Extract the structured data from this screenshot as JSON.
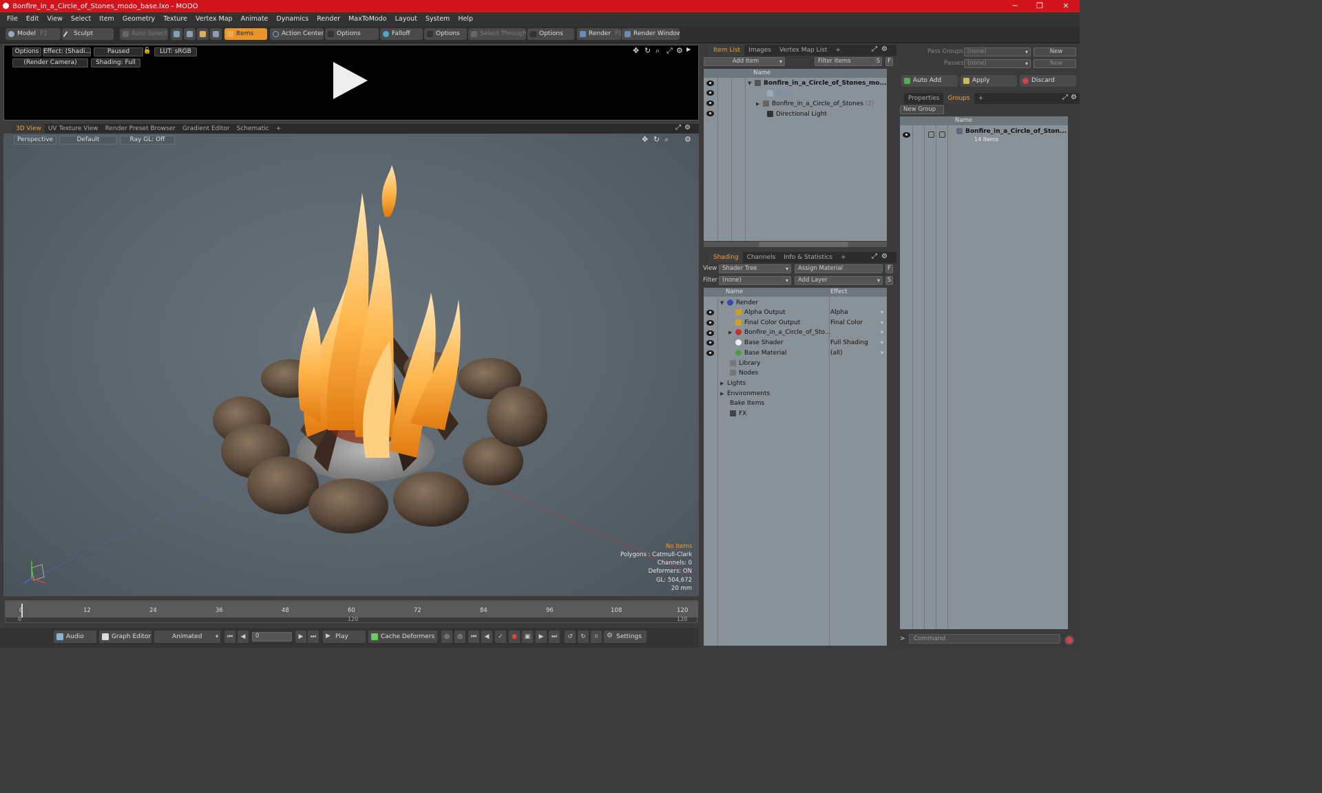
{
  "window": {
    "title": "Bonfire_in_a_Circle_of_Stones_modo_base.lxo - MODO",
    "minimize": "─",
    "restore": "❐",
    "close": "✕"
  },
  "menu": [
    "File",
    "Edit",
    "View",
    "Select",
    "Item",
    "Geometry",
    "Texture",
    "Vertex Map",
    "Animate",
    "Dynamics",
    "Render",
    "MaxToModo",
    "Layout",
    "System",
    "Help"
  ],
  "toolbar": {
    "model": "Model",
    "model_hotkey": "F2",
    "sculpt": "Sculpt",
    "auto_select": "Auto Select",
    "items": "Items",
    "action_center": "Action Center",
    "options1": "Options",
    "falloff": "Falloff",
    "options2": "Options",
    "select_through": "Select Through",
    "options3": "Options",
    "render": "Render",
    "render_hotkey": "F9",
    "render_window": "Render Window"
  },
  "preview": {
    "options": "Options",
    "effect": "Effect: (Shadi...",
    "paused": "Paused",
    "lut": "LUT: sRGB",
    "camera": "(Render Camera)",
    "shading": "Shading: Full"
  },
  "view_tabs": [
    "3D View",
    "UV Texture View",
    "Render Preset Browser",
    "Gradient Editor",
    "Schematic",
    "+"
  ],
  "viewport": {
    "perspective": "Perspective",
    "default": "Default",
    "raygl": "Ray GL: Off",
    "hud": [
      "No Items",
      "Polygons : Catmull-Clark",
      "Channels: 0",
      "Deformers: ON",
      "GL: 504,672",
      "20 mm"
    ]
  },
  "timeline": {
    "ticks": [
      "0",
      "12",
      "24",
      "36",
      "48",
      "60",
      "72",
      "84",
      "96",
      "108",
      "120"
    ],
    "start": "0",
    "mid": "120",
    "end": "120"
  },
  "transport": {
    "audio": "Audio",
    "graph_editor": "Graph Editor",
    "animated": "Animated",
    "frame": "0",
    "play": "Play",
    "cache_deformers": "Cache Deformers",
    "settings": "Settings"
  },
  "item_list": {
    "tabs": [
      "Item List",
      "Images",
      "Vertex Map List",
      "+"
    ],
    "add_item": "Add Item",
    "filter_items": "Filter Items",
    "s": "S",
    "f": "F",
    "col_name": "Name",
    "rows": [
      {
        "label": "Bonfire_in_a_Circle_of_Stones_mo...",
        "bold": true
      },
      {
        "label": "Mesh",
        "dim": true
      },
      {
        "label": "Bonfire_in_a_Circle_of_Stones",
        "count": "(2)"
      },
      {
        "label": "Directional Light"
      }
    ]
  },
  "shading": {
    "tabs": [
      "Shading",
      "Channels",
      "Info & Statistics",
      "+"
    ],
    "view_label": "View",
    "view_value": "Shader Tree",
    "assign_material": "Assign Material",
    "filter_label": "Filter",
    "filter_value": "(none)",
    "add_layer": "Add Layer",
    "col_name": "Name",
    "col_effect": "Effect",
    "rows": [
      {
        "label": "Render",
        "effect": ""
      },
      {
        "label": "Alpha Output",
        "effect": "Alpha"
      },
      {
        "label": "Final Color Output",
        "effect": "Final Color"
      },
      {
        "label": "Bonfire_in_a_Circle_of_Sto...",
        "effect": ""
      },
      {
        "label": "Base Shader",
        "effect": "Full Shading"
      },
      {
        "label": "Base Material",
        "effect": "(all)"
      },
      {
        "label": "Library",
        "effect": ""
      },
      {
        "label": "Nodes",
        "effect": ""
      },
      {
        "label": "Lights",
        "effect": ""
      },
      {
        "label": "Environments",
        "effect": ""
      },
      {
        "label": "Bake Items",
        "effect": ""
      },
      {
        "label": "FX",
        "effect": ""
      }
    ]
  },
  "groups": {
    "pass_groups": "Pass Groups",
    "pass_groups_value": "(none)",
    "new": "New",
    "passes": "Passes",
    "passes_value": "(none)",
    "new2": "New",
    "auto_add": "Auto Add",
    "apply": "Apply",
    "discard": "Discard",
    "tabs": [
      "Properties",
      "Groups",
      "+"
    ],
    "new_group": "New Group",
    "col_name": "Name",
    "item_name": "Bonfire_in_a_Circle_of_Ston...",
    "item_count": "14 Items"
  },
  "command": {
    "placeholder": "Command"
  }
}
